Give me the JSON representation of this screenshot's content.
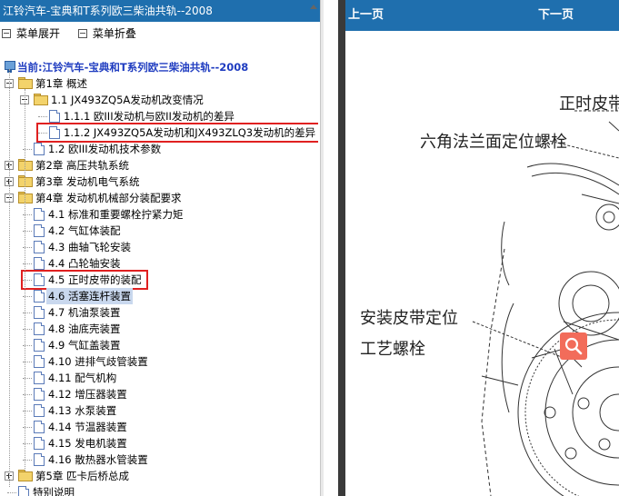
{
  "left_panel": {
    "title": "江铃汽车-宝典和T系列欧三柴油共轨--2008",
    "menu": {
      "expand": "菜单展开",
      "collapse": "菜单折叠"
    },
    "root_label": "当前:江铃汽车-宝典和T系列欧三柴油共轨--2008",
    "tree": [
      {
        "label": "第1章 概述",
        "type": "folder",
        "level": 0,
        "expander": "minus"
      },
      {
        "label": "1.1 JX493ZQ5A发动机改变情况",
        "type": "folder",
        "level": 1,
        "expander": "minus"
      },
      {
        "label": "1.1.1 欧III发动机与欧II发动机的差异",
        "type": "doc",
        "level": 2
      },
      {
        "label": "1.1.2 JX493ZQ5A发动机和JX493ZLQ3发动机的差异",
        "type": "doc",
        "level": 2,
        "highlight": true
      },
      {
        "label": "1.2 欧III发动机技术参数",
        "type": "doc",
        "level": 1
      },
      {
        "label": "第2章 高压共轨系统",
        "type": "folder",
        "level": 0,
        "expander": "plus"
      },
      {
        "label": "第3章 发动机电气系统",
        "type": "folder",
        "level": 0,
        "expander": "plus"
      },
      {
        "label": "第4章 发动机机械部分装配要求",
        "type": "folder",
        "level": 0,
        "expander": "minus"
      },
      {
        "label": "4.1 标准和重要螺栓拧紧力矩",
        "type": "doc",
        "level": 1
      },
      {
        "label": "4.2 气缸体装配",
        "type": "doc",
        "level": 1
      },
      {
        "label": "4.3 曲轴飞轮安装",
        "type": "doc",
        "level": 1
      },
      {
        "label": "4.4 凸轮轴安装",
        "type": "doc",
        "level": 1
      },
      {
        "label": "4.5 正时皮带的装配",
        "type": "doc",
        "level": 1,
        "highlight": true
      },
      {
        "label": "4.6 活塞连杆装置",
        "type": "doc",
        "level": 1,
        "selected": true
      },
      {
        "label": "4.7 机油泵装置",
        "type": "doc",
        "level": 1
      },
      {
        "label": "4.8 油底壳装置",
        "type": "doc",
        "level": 1
      },
      {
        "label": "4.9 气缸盖装置",
        "type": "doc",
        "level": 1
      },
      {
        "label": "4.10 进排气歧管装置",
        "type": "doc",
        "level": 1
      },
      {
        "label": "4.11 配气机构",
        "type": "doc",
        "level": 1
      },
      {
        "label": "4.12 增压器装置",
        "type": "doc",
        "level": 1
      },
      {
        "label": "4.13 水泵装置",
        "type": "doc",
        "level": 1
      },
      {
        "label": "4.14 节温器装置",
        "type": "doc",
        "level": 1
      },
      {
        "label": "4.15 发电机装置",
        "type": "doc",
        "level": 1
      },
      {
        "label": "4.16 散热器水管装置",
        "type": "doc",
        "level": 1
      },
      {
        "label": "第5章 匹卡后桥总成",
        "type": "folder",
        "level": 0,
        "expander": "plus"
      },
      {
        "label": "特别说明",
        "type": "doc",
        "level": 0
      }
    ]
  },
  "right_panel": {
    "prev_label": "上一页",
    "next_label": "下一页",
    "drawing_labels": {
      "timing_belt": "正时皮带",
      "hex_flange": "六角法兰面定位螺栓",
      "install_belt_line1": "安装皮带定位",
      "install_belt_line2": "工艺螺栓"
    },
    "zoom_icon": "magnifier-icon",
    "colors": {
      "header": "#1f6fae",
      "zoom_button": "#f26c5a",
      "highlight": "#e02020"
    }
  }
}
